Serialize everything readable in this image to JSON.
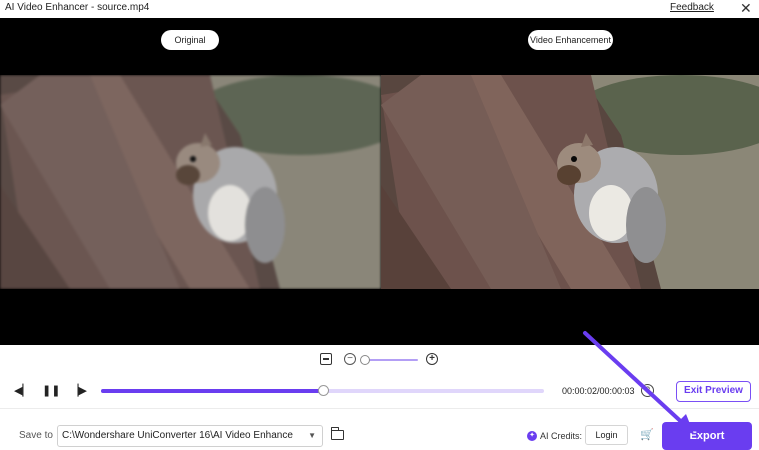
{
  "window": {
    "title": "AI Video Enhancer - source.mp4",
    "feedback_label": "Feedback",
    "close_symbol": "✕"
  },
  "viewer": {
    "left_label": "Original",
    "right_label": "Video Enhancement"
  },
  "zoom": {
    "level": 0.05
  },
  "playback": {
    "progress": 0.5,
    "timecode": "00:00:02/00:00:03",
    "help_symbol": "?",
    "exit_preview_label": "Exit Preview"
  },
  "footer": {
    "save_to_label": "Save to",
    "save_path": "C:\\Wondershare UniConverter 16\\AI Video Enhance",
    "ai_credits_label": "AI Credits:",
    "login_label": "Login",
    "export_label": "Export"
  },
  "colors": {
    "accent": "#6a3df0",
    "accent_light": "#e0d6fb",
    "viewer_bg": "#000000"
  },
  "icons": [
    "close-icon",
    "fit-icon",
    "zoom-out-icon",
    "zoom-in-icon",
    "previous-frame-icon",
    "pause-icon",
    "next-frame-icon",
    "help-icon",
    "chevron-down-icon",
    "folder-icon",
    "ai-credits-icon",
    "cart-icon"
  ]
}
